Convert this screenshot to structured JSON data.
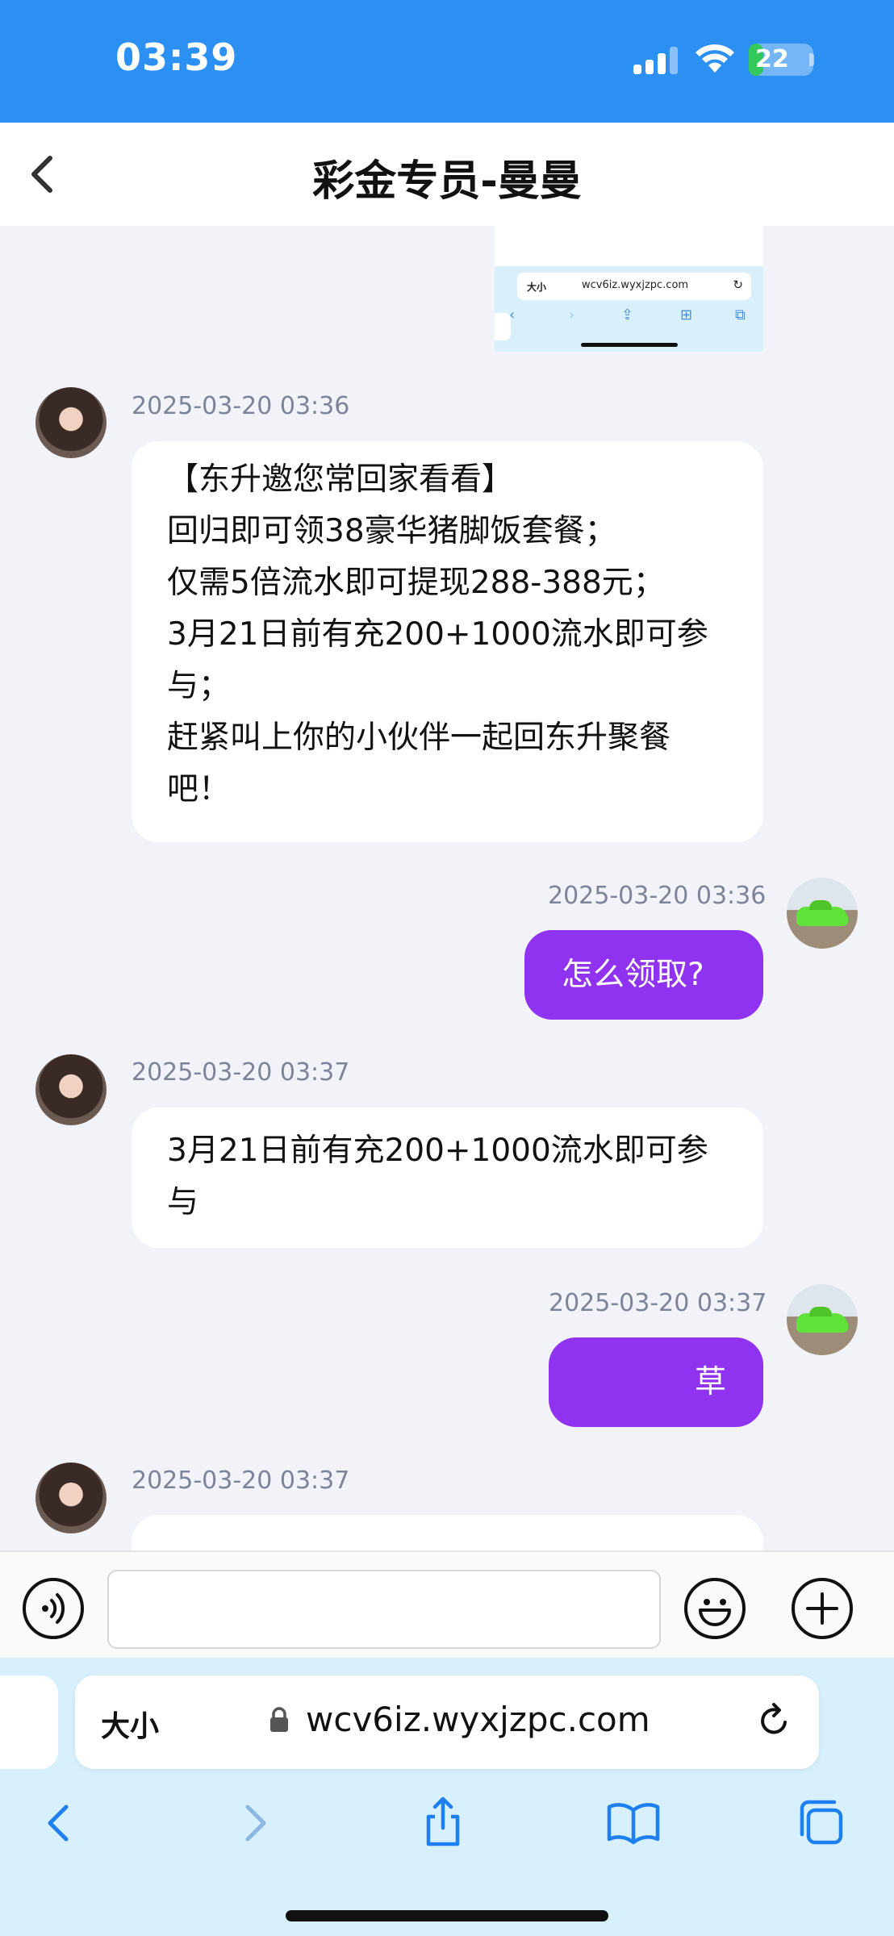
{
  "status_bar": {
    "time": "03:39",
    "battery": "22",
    "battery_level": 0.22
  },
  "header": {
    "title": "彩金专员-曼曼"
  },
  "thumbnail": {
    "aa": "大小",
    "url": "wcv6iz.wyxjzpc.com",
    "reload": "↻",
    "nav": [
      "‹",
      "›",
      "⇪",
      "⊞",
      "⧉"
    ]
  },
  "messages": [
    {
      "side": "left",
      "time": "2025-03-20 03:36",
      "lines": [
        "【东升邀您常回家看看】",
        "回归即可领38豪华猪脚饭套餐；",
        "仅需5倍流水即可提现288-388元；",
        "3月21日前有充200+1000流水即可参",
        "与；",
        "赶紧叫上你的小伙伴一起回东升聚餐",
        "吧！"
      ]
    },
    {
      "side": "right",
      "time": "2025-03-20 03:36",
      "lines": [
        "怎么领取?"
      ]
    },
    {
      "side": "left",
      "time": "2025-03-20 03:37",
      "lines": [
        "3月21日前有充200+1000流水即可参",
        "与"
      ]
    },
    {
      "side": "right",
      "time": "2025-03-20 03:37",
      "lines": [
        "草"
      ]
    },
    {
      "side": "left",
      "time": "2025-03-20 03:37",
      "lines": []
    }
  ],
  "input_bar": {
    "placeholder": ""
  },
  "browser": {
    "aa_label": "大小",
    "url": "wcv6iz.wyxjzpc.com"
  },
  "colors": {
    "status_bar": "#2c8ff2",
    "my_bubble": "#9033f0",
    "chat_bg": "#f2f3f8",
    "browser_bg": "#d7f0fc"
  }
}
